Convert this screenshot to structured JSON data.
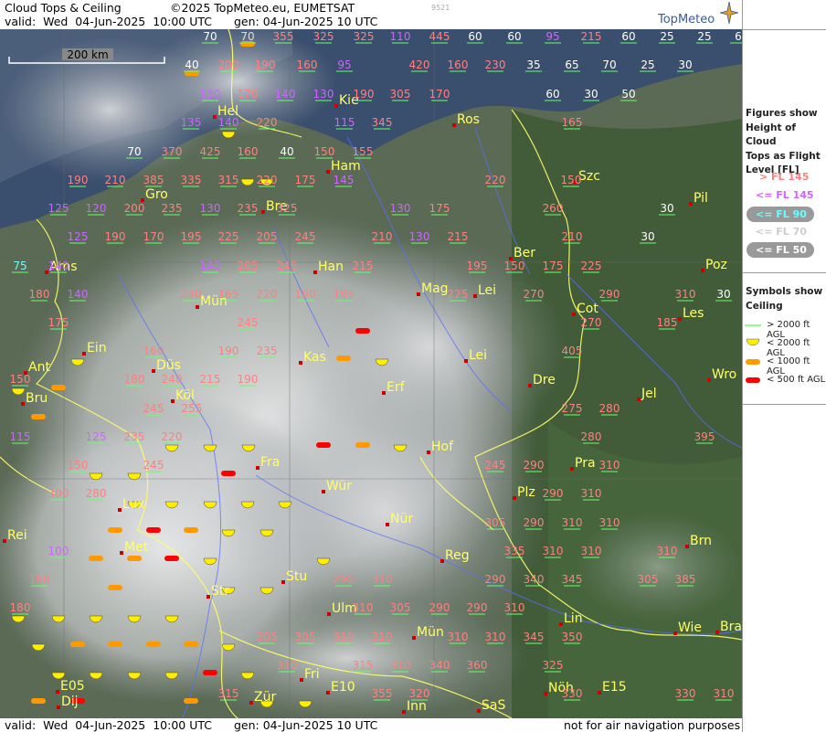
{
  "header": {
    "title": "Cloud Tops & Ceiling",
    "credit": "©2025 TopMeteo.eu, EUMETSAT",
    "image_id": "9521",
    "valid": "valid:  Wed  04-Jun-2025  10:00 UTC",
    "gen": "gen: 04-Jun-2025 10 UTC",
    "brand": "TopMeteo"
  },
  "footer": {
    "valid": "valid:  Wed  04-Jun-2025  10:00 UTC",
    "gen": "gen: 04-Jun-2025 10 UTC",
    "disclaimer": "not for air navigation purposes"
  },
  "scale_bar": {
    "label": "200 km"
  },
  "legend": {
    "figures_title": [
      "Figures show",
      "Height of Cloud",
      "Tops as Flight",
      "Level  [FL]"
    ],
    "figures": [
      {
        "label": "> FL 145",
        "color": "#ff8080"
      },
      {
        "label": "<= FL 145",
        "color": "#cc66ff"
      },
      {
        "label": "<= FL 90",
        "color": "#66ffff"
      },
      {
        "label": "<= FL 70",
        "color": "#cccccc"
      },
      {
        "label": "<= FL 50",
        "color": "#ffffff"
      }
    ],
    "symbols_title": [
      "Symbols show",
      "Ceiling"
    ],
    "symbols": [
      {
        "label": "> 2000 ft AGL",
        "icon": "green-line-icon"
      },
      {
        "label": "< 2000 ft AGL",
        "icon": "yellow-half-circle-icon"
      },
      {
        "label": "< 1000 ft AGL",
        "icon": "orange-bar-icon"
      },
      {
        "label": "< 500 ft AGL",
        "icon": "red-bar-icon"
      }
    ]
  },
  "cities": [
    [
      "Hel",
      235,
      122
    ],
    [
      "Kie",
      368,
      110
    ],
    [
      "Ros",
      497,
      131
    ],
    [
      "Ham",
      359,
      182
    ],
    [
      "Szc",
      630,
      193
    ],
    [
      "Gro",
      156,
      213
    ],
    [
      "Bre",
      288,
      226
    ],
    [
      "Pil",
      756,
      217
    ],
    [
      "Ber",
      559,
      277
    ],
    [
      "Ams",
      51,
      292
    ],
    [
      "Han",
      345,
      292
    ],
    [
      "Poz",
      769,
      290
    ],
    [
      "Mag",
      458,
      316
    ],
    [
      "Lei",
      520,
      318
    ],
    [
      "Mün",
      216,
      330
    ],
    [
      "Cot",
      628,
      338
    ],
    [
      "Les",
      744,
      343
    ],
    [
      "Ein",
      92,
      381
    ],
    [
      "Kas",
      329,
      391
    ],
    [
      "Lei",
      510,
      389
    ],
    [
      "Ant",
      28,
      402
    ],
    [
      "Düs",
      168,
      400
    ],
    [
      "Dre",
      580,
      416
    ],
    [
      "Wro",
      776,
      410
    ],
    [
      "Erf",
      420,
      424
    ],
    [
      "Bru",
      25,
      436
    ],
    [
      "Köl",
      189,
      433
    ],
    [
      "Jel",
      699,
      431
    ],
    [
      "Hof",
      469,
      489
    ],
    [
      "Fra",
      282,
      506
    ],
    [
      "Pra",
      626,
      507
    ],
    [
      "Wür",
      354,
      532
    ],
    [
      "Plz",
      563,
      539
    ],
    [
      "Lux",
      131,
      552
    ],
    [
      "Nür",
      424,
      568
    ],
    [
      "Rei",
      5,
      586
    ],
    [
      "Met",
      133,
      599
    ],
    [
      "Brn",
      752,
      592
    ],
    [
      "Reg",
      484,
      608
    ],
    [
      "Stu",
      310,
      631
    ],
    [
      "Str",
      228,
      647
    ],
    [
      "Ulm",
      360,
      666
    ],
    [
      "Lin",
      614,
      677
    ],
    [
      "Mün",
      453,
      692
    ],
    [
      "Wie",
      739,
      687
    ],
    [
      "Bra",
      785,
      686
    ],
    [
      "Fri",
      330,
      738
    ],
    [
      "Inn",
      442,
      773
    ],
    [
      "Nöh",
      597,
      753
    ],
    [
      "E05",
      63,
      751
    ],
    [
      "E10",
      359,
      752
    ],
    [
      "E15",
      656,
      752
    ],
    [
      "Zür",
      275,
      763
    ],
    [
      "SaS",
      524,
      772
    ],
    [
      "Dij",
      64,
      768
    ]
  ],
  "values": [
    [
      "70",
      230,
      40,
      "#ffffff"
    ],
    [
      "70",
      271,
      40,
      "#dddddd"
    ],
    [
      "355",
      310,
      40,
      "#ff8080"
    ],
    [
      "325",
      354,
      40,
      "#ff8080"
    ],
    [
      "325",
      398,
      40,
      "#ff8080"
    ],
    [
      "110",
      438,
      40,
      "#cc66ff"
    ],
    [
      "445",
      481,
      40,
      "#ff8080"
    ],
    [
      "60",
      520,
      40,
      "#ffffff"
    ],
    [
      "60",
      563,
      40,
      "#ffffff"
    ],
    [
      "95",
      605,
      40,
      "#cc66ff"
    ],
    [
      "215",
      647,
      40,
      "#ff8080"
    ],
    [
      "60",
      688,
      40,
      "#ffffff"
    ],
    [
      "25",
      730,
      40,
      "#ffffff"
    ],
    [
      "25",
      771,
      40,
      "#ffffff"
    ],
    [
      "6",
      808,
      40,
      "#ffffff"
    ],
    [
      "40",
      210,
      71,
      "#ffffff"
    ],
    [
      "200",
      250,
      71,
      "#ff8080"
    ],
    [
      "190",
      290,
      71,
      "#ff8080"
    ],
    [
      "160",
      336,
      71,
      "#ff8080"
    ],
    [
      "95",
      377,
      71,
      "#cc66ff"
    ],
    [
      "420",
      459,
      71,
      "#ff8080"
    ],
    [
      "160",
      501,
      71,
      "#ff8080"
    ],
    [
      "230",
      542,
      71,
      "#ff8080"
    ],
    [
      "35",
      584,
      71,
      "#ffffff"
    ],
    [
      "65",
      626,
      71,
      "#ffffff"
    ],
    [
      "70",
      667,
      71,
      "#ffffff"
    ],
    [
      "25",
      709,
      71,
      "#ffffff"
    ],
    [
      "30",
      750,
      71,
      "#ffffff"
    ],
    [
      "130",
      230,
      103,
      "#cc66ff"
    ],
    [
      "170",
      271,
      103,
      "#ff8080"
    ],
    [
      "140",
      312,
      103,
      "#cc66ff"
    ],
    [
      "130",
      354,
      103,
      "#cc66ff"
    ],
    [
      "190",
      398,
      103,
      "#ff8080"
    ],
    [
      "305",
      438,
      103,
      "#ff8080"
    ],
    [
      "170",
      481,
      103,
      "#ff8080"
    ],
    [
      "60",
      605,
      103,
      "#ffffff"
    ],
    [
      "30",
      647,
      103,
      "#ffffff"
    ],
    [
      "50",
      688,
      103,
      "#ffffff"
    ],
    [
      "135",
      209,
      134,
      "#cc66ff"
    ],
    [
      "140",
      250,
      134,
      "#cc66ff"
    ],
    [
      "220",
      292,
      134,
      "#ff8080"
    ],
    [
      "115",
      377,
      134,
      "#cc66ff"
    ],
    [
      "345",
      418,
      134,
      "#ff8080"
    ],
    [
      "165",
      626,
      134,
      "#ff8080"
    ],
    [
      "70",
      147,
      166,
      "#ffffff"
    ],
    [
      "370",
      188,
      166,
      "#ff8080"
    ],
    [
      "425",
      230,
      166,
      "#ff8080"
    ],
    [
      "160",
      271,
      166,
      "#ff8080"
    ],
    [
      "40",
      314,
      166,
      "#ffffff"
    ],
    [
      "150",
      355,
      166,
      "#ff8080"
    ],
    [
      "155",
      397,
      166,
      "#ff8080"
    ],
    [
      "190",
      85,
      197,
      "#ff8080"
    ],
    [
      "210",
      126,
      197,
      "#ff8080"
    ],
    [
      "385",
      168,
      197,
      "#ff8080"
    ],
    [
      "335",
      209,
      197,
      "#ff8080"
    ],
    [
      "315",
      250,
      197,
      "#ff8080"
    ],
    [
      "220",
      292,
      197,
      "#ff8080"
    ],
    [
      "175",
      334,
      197,
      "#ff8080"
    ],
    [
      "145",
      376,
      197,
      "#cc66ff"
    ],
    [
      "220",
      542,
      197,
      "#ff8080"
    ],
    [
      "150",
      625,
      197,
      "#ff8080"
    ],
    [
      "125",
      64,
      228,
      "#cc66ff"
    ],
    [
      "120",
      105,
      228,
      "#cc66ff"
    ],
    [
      "200",
      147,
      228,
      "#ff8080"
    ],
    [
      "235",
      188,
      228,
      "#ff8080"
    ],
    [
      "130",
      230,
      228,
      "#cc66ff"
    ],
    [
      "235",
      271,
      228,
      "#ff8080"
    ],
    [
      "325",
      314,
      228,
      "#ff8080"
    ],
    [
      "130",
      438,
      228,
      "#cc66ff"
    ],
    [
      "175",
      481,
      228,
      "#ff8080"
    ],
    [
      "260",
      605,
      228,
      "#ff8080"
    ],
    [
      "30",
      730,
      228,
      "#ffffff"
    ],
    [
      "125",
      85,
      259,
      "#cc66ff"
    ],
    [
      "190",
      126,
      259,
      "#ff8080"
    ],
    [
      "170",
      168,
      259,
      "#ff8080"
    ],
    [
      "195",
      209,
      259,
      "#ff8080"
    ],
    [
      "225",
      250,
      259,
      "#ff8080"
    ],
    [
      "205",
      292,
      259,
      "#ff8080"
    ],
    [
      "245",
      334,
      259,
      "#ff8080"
    ],
    [
      "210",
      418,
      259,
      "#ff8080"
    ],
    [
      "130",
      459,
      259,
      "#cc66ff"
    ],
    [
      "215",
      501,
      259,
      "#ff8080"
    ],
    [
      "210",
      626,
      259,
      "#ff8080"
    ],
    [
      "30",
      709,
      259,
      "#ffffff"
    ],
    [
      "75",
      22,
      291,
      "#66ffff"
    ],
    [
      "140",
      64,
      291,
      "#cc66ff"
    ],
    [
      "140",
      230,
      291,
      "#cc66ff"
    ],
    [
      "205",
      271,
      291,
      "#ff8080"
    ],
    [
      "245",
      314,
      291,
      "#ff8080"
    ],
    [
      "215",
      397,
      291,
      "#ff8080"
    ],
    [
      "195",
      522,
      291,
      "#ff8080"
    ],
    [
      "150",
      563,
      291,
      "#ff8080"
    ],
    [
      "175",
      605,
      291,
      "#ff8080"
    ],
    [
      "225",
      647,
      291,
      "#ff8080"
    ],
    [
      "180",
      43,
      322,
      "#ff8080"
    ],
    [
      "140",
      85,
      322,
      "#cc66ff"
    ],
    [
      "230",
      209,
      322,
      "#ff8080"
    ],
    [
      "165",
      250,
      322,
      "#ff8080"
    ],
    [
      "220",
      292,
      322,
      "#ff8080"
    ],
    [
      "180",
      334,
      322,
      "#ff8080"
    ],
    [
      "185",
      376,
      322,
      "#ff8080"
    ],
    [
      "225",
      501,
      322,
      "#ff8080"
    ],
    [
      "270",
      584,
      322,
      "#ff8080"
    ],
    [
      "290",
      667,
      322,
      "#ff8080"
    ],
    [
      "310",
      750,
      322,
      "#ff8080"
    ],
    [
      "30",
      792,
      322,
      "#ffffff"
    ],
    [
      "175",
      64,
      353,
      "#ff8080"
    ],
    [
      "245",
      271,
      353,
      "#ff8080"
    ],
    [
      "270",
      647,
      353,
      "#ff8080"
    ],
    [
      "185",
      730,
      353,
      "#ff8080"
    ],
    [
      "190",
      250,
      384,
      "#ff8080"
    ],
    [
      "160",
      168,
      384,
      "#ff8080"
    ],
    [
      "235",
      292,
      384,
      "#ff8080"
    ],
    [
      "405",
      626,
      384,
      "#ff8080"
    ],
    [
      "150",
      22,
      415,
      "#ff8080"
    ],
    [
      "180",
      147,
      415,
      "#ff8080"
    ],
    [
      "240",
      188,
      415,
      "#ff8080"
    ],
    [
      "215",
      230,
      415,
      "#ff8080"
    ],
    [
      "190",
      271,
      415,
      "#ff8080"
    ],
    [
      "255",
      210,
      447,
      "#ff8080"
    ],
    [
      "245",
      168,
      447,
      "#ff8080"
    ],
    [
      "275",
      626,
      447,
      "#ff8080"
    ],
    [
      "280",
      667,
      447,
      "#ff8080"
    ],
    [
      "115",
      22,
      478,
      "#cc66ff"
    ],
    [
      "125",
      105,
      478,
      "#cc66ff"
    ],
    [
      "235",
      147,
      478,
      "#ff8080"
    ],
    [
      "220",
      188,
      478,
      "#ff8080"
    ],
    [
      "280",
      647,
      478,
      "#ff8080"
    ],
    [
      "395",
      771,
      478,
      "#ff8080"
    ],
    [
      "150",
      85,
      509,
      "#ff8080"
    ],
    [
      "245",
      168,
      509,
      "#ff8080"
    ],
    [
      "245",
      542,
      509,
      "#ff8080"
    ],
    [
      "290",
      584,
      509,
      "#ff8080"
    ],
    [
      "310",
      667,
      509,
      "#ff8080"
    ],
    [
      "300",
      64,
      540,
      "#ff8080"
    ],
    [
      "280",
      105,
      540,
      "#ff8080"
    ],
    [
      "290",
      605,
      540,
      "#ff8080"
    ],
    [
      "310",
      647,
      540,
      "#ff8080"
    ],
    [
      "305",
      542,
      572,
      "#ff8080"
    ],
    [
      "290",
      584,
      572,
      "#ff8080"
    ],
    [
      "310",
      626,
      572,
      "#ff8080"
    ],
    [
      "310",
      667,
      572,
      "#ff8080"
    ],
    [
      "100",
      64,
      603,
      "#cc66ff"
    ],
    [
      "335",
      563,
      603,
      "#ff8080"
    ],
    [
      "310",
      605,
      603,
      "#ff8080"
    ],
    [
      "310",
      647,
      603,
      "#ff8080"
    ],
    [
      "310",
      730,
      603,
      "#ff8080"
    ],
    [
      "160",
      43,
      634,
      "#ff8080"
    ],
    [
      "290",
      376,
      634,
      "#ff8080"
    ],
    [
      "310",
      418,
      634,
      "#ff8080"
    ],
    [
      "290",
      542,
      634,
      "#ff8080"
    ],
    [
      "340",
      584,
      634,
      "#ff8080"
    ],
    [
      "345",
      626,
      634,
      "#ff8080"
    ],
    [
      "305",
      709,
      634,
      "#ff8080"
    ],
    [
      "385",
      750,
      634,
      "#ff8080"
    ],
    [
      "180",
      22,
      665,
      "#ff8080"
    ],
    [
      "310",
      397,
      665,
      "#ff8080"
    ],
    [
      "305",
      438,
      665,
      "#ff8080"
    ],
    [
      "290",
      481,
      665,
      "#ff8080"
    ],
    [
      "290",
      522,
      665,
      "#ff8080"
    ],
    [
      "310",
      563,
      665,
      "#ff8080"
    ],
    [
      "305",
      292,
      697,
      "#ff8080"
    ],
    [
      "305",
      334,
      697,
      "#ff8080"
    ],
    [
      "310",
      376,
      697,
      "#ff8080"
    ],
    [
      "310",
      418,
      697,
      "#ff8080"
    ],
    [
      "310",
      501,
      697,
      "#ff8080"
    ],
    [
      "310",
      542,
      697,
      "#ff8080"
    ],
    [
      "345",
      584,
      697,
      "#ff8080"
    ],
    [
      "350",
      626,
      697,
      "#ff8080"
    ],
    [
      "310",
      314,
      728,
      "#ff8080"
    ],
    [
      "315",
      397,
      728,
      "#ff8080"
    ],
    [
      "310",
      438,
      728,
      "#ff8080"
    ],
    [
      "340",
      481,
      728,
      "#ff8080"
    ],
    [
      "360",
      522,
      728,
      "#ff8080"
    ],
    [
      "325",
      605,
      728,
      "#ff8080"
    ],
    [
      "315",
      250,
      759,
      "#ff8080"
    ],
    [
      "320",
      459,
      759,
      "#ff8080"
    ],
    [
      "355",
      418,
      759,
      "#ff8080"
    ],
    [
      "330",
      626,
      759,
      "#ff8080"
    ],
    [
      "330",
      750,
      759,
      "#ff8080"
    ],
    [
      "310",
      792,
      759,
      "#ff8080"
    ]
  ],
  "symbols": [
    [
      "half",
      250,
      144
    ],
    [
      "half",
      271,
      196
    ],
    [
      "half",
      292,
      196
    ],
    [
      "bar",
      210,
      80,
      "#ff9900"
    ],
    [
      "bar",
      271,
      48,
      "#ff9900"
    ],
    [
      "bar",
      397,
      362,
      "#ff0000"
    ],
    [
      "bar",
      376,
      392,
      "#ff9900"
    ],
    [
      "half",
      418,
      393
    ],
    [
      "half",
      20,
      425
    ],
    [
      "bar",
      64,
      424,
      "#ff9900"
    ],
    [
      "half",
      85,
      393
    ],
    [
      "half",
      230,
      487
    ],
    [
      "half",
      272,
      487
    ],
    [
      "half",
      438,
      487
    ],
    [
      "bar",
      354,
      487,
      "#ff0000"
    ],
    [
      "bar",
      397,
      487,
      "#ff9900"
    ],
    [
      "bar",
      250,
      518,
      "#ff0000"
    ],
    [
      "bar",
      42,
      456,
      "#ff9900"
    ],
    [
      "half",
      188,
      487
    ],
    [
      "half",
      105,
      518
    ],
    [
      "half",
      147,
      518
    ],
    [
      "bar",
      168,
      580,
      "#ff0000"
    ],
    [
      "bar",
      126,
      580,
      "#ff9900"
    ],
    [
      "bar",
      209,
      580,
      "#ff9900"
    ],
    [
      "half",
      250,
      580
    ],
    [
      "half",
      292,
      580
    ],
    [
      "bar",
      188,
      611,
      "#ff0000"
    ],
    [
      "bar",
      105,
      611,
      "#ff9900"
    ],
    [
      "bar",
      147,
      611,
      "#ff9900"
    ],
    [
      "half",
      230,
      611
    ],
    [
      "half",
      354,
      611
    ],
    [
      "half",
      147,
      549
    ],
    [
      "half",
      188,
      549
    ],
    [
      "half",
      230,
      549
    ],
    [
      "half",
      271,
      549
    ],
    [
      "half",
      312,
      549
    ],
    [
      "half",
      20,
      674
    ],
    [
      "half",
      64,
      674
    ],
    [
      "half",
      105,
      674
    ],
    [
      "half",
      147,
      674
    ],
    [
      "half",
      188,
      674
    ],
    [
      "half",
      250,
      643
    ],
    [
      "half",
      292,
      643
    ],
    [
      "bar",
      126,
      643,
      "#ff9900"
    ],
    [
      "bar",
      85,
      705,
      "#ff9900"
    ],
    [
      "bar",
      126,
      705,
      "#ff9900"
    ],
    [
      "bar",
      168,
      705,
      "#ff9900"
    ],
    [
      "bar",
      209,
      705,
      "#ff9900"
    ],
    [
      "half",
      42,
      705
    ],
    [
      "half",
      250,
      705
    ],
    [
      "bar",
      230,
      736,
      "#ff0000"
    ],
    [
      "half",
      271,
      736
    ],
    [
      "half",
      188,
      736
    ],
    [
      "half",
      147,
      736
    ],
    [
      "half",
      105,
      736
    ],
    [
      "half",
      64,
      736
    ],
    [
      "bar",
      85,
      767,
      "#ff0000"
    ],
    [
      "bar",
      42,
      767,
      "#ff9900"
    ],
    [
      "bar",
      209,
      767,
      "#ff9900"
    ],
    [
      "half",
      292,
      767
    ],
    [
      "half",
      334,
      767
    ]
  ]
}
